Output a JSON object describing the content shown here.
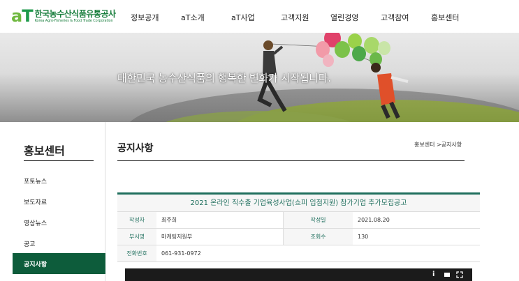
{
  "logo": {
    "mark_a": "a",
    "mark_t": "T",
    "name_ko": "한국농수산식품유통공사",
    "name_en": "Korea Agro-Fisheries & Food Trade Corporation"
  },
  "nav": {
    "items": [
      "정보공개",
      "aT소개",
      "aT사업",
      "고객지원",
      "열린경영",
      "고객참여",
      "홍보센터"
    ]
  },
  "banner": {
    "tagline": "대한민국 농수산식품의 행복한 변화가 시작됩니다."
  },
  "sidebar": {
    "title": "홍보센터",
    "items": [
      "포토뉴스",
      "보도자료",
      "영상뉴스",
      "공고",
      "공지사항"
    ],
    "active": "공지사항"
  },
  "main": {
    "page_title": "공지사항",
    "breadcrumb": "홍보센터 >공지사항",
    "notice": {
      "title": "2021 온라인 직수출 기업육성사업(쇼피 입점지원) 참가기업 추가모집공고",
      "fields": {
        "author_label": "작성자",
        "author": "최주희",
        "date_label": "작성일",
        "date": "2021.08.20",
        "dept_label": "부서명",
        "dept": "마케팅지원부",
        "views_label": "조회수",
        "views": "130",
        "phone_label": "전화번호",
        "phone": "061-931-0972"
      }
    }
  },
  "colors": {
    "brand_green": "#1e9a4b",
    "sidebar_active": "#0d5c3b",
    "table_accent": "#1f6f5d"
  },
  "video": {
    "icons": [
      "info-icon",
      "screen-icon",
      "fullscreen-icon"
    ]
  }
}
